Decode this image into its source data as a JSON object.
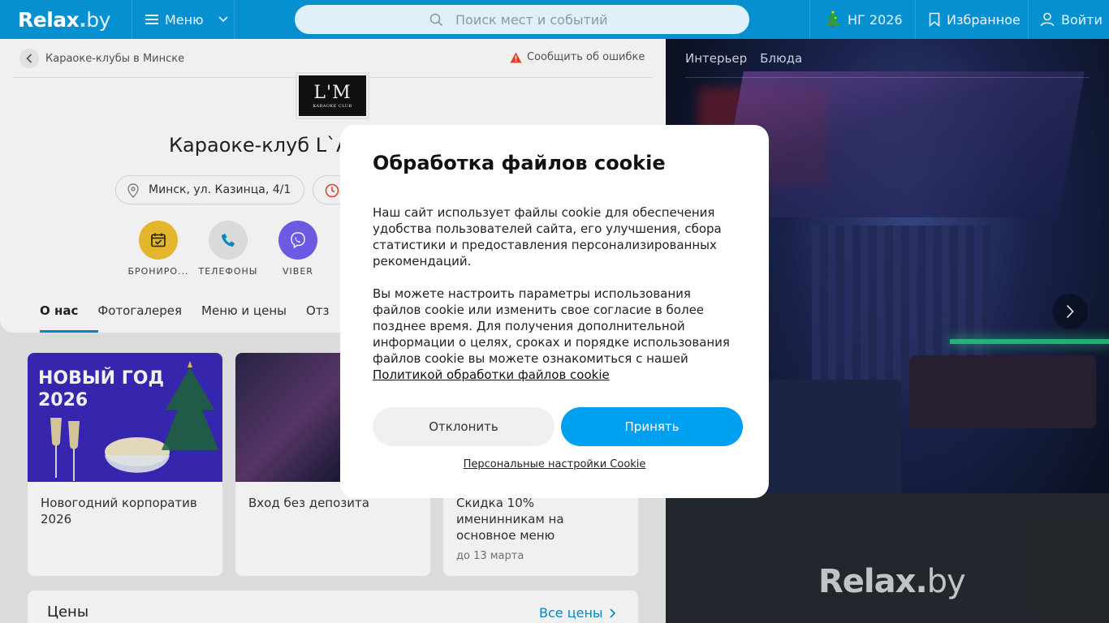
{
  "header": {
    "logo_main": "Relax",
    "logo_dot": ".",
    "logo_by": "by",
    "menu_label": "Меню",
    "search_placeholder": "Поиск мест и событий",
    "ng_label": "НГ 2026",
    "favorites_label": "Избранное",
    "login_label": "Войти",
    "colors": {
      "header_bg": "#0690d0",
      "accent": "#00a0f0"
    }
  },
  "venue": {
    "breadcrumb": "Караоке-клубы в Минске",
    "report_error": "Сообщить об ошибке",
    "logo_text": "L'M",
    "logo_sub": "KARAOKE CLUB",
    "title": "Караоке-клуб L`A",
    "address": "Минск, ул. Казинца, 4/1",
    "actions": [
      {
        "label": "БРОНИРО...",
        "icon": "calendar-check-icon",
        "color": "#f2c230"
      },
      {
        "label": "ТЕЛЕФОНЫ",
        "icon": "phone-icon",
        "color": "#e8e8e8"
      },
      {
        "label": "VIBER",
        "icon": "viber-icon",
        "color": "#7360f2"
      }
    ],
    "tabs": [
      "О нас",
      "Фотогалерея",
      "Меню и цены",
      "Отз"
    ]
  },
  "promos": [
    {
      "image_title": "НОВЫЙ ГОД\n2026",
      "text": "Новогодний корпоратив 2026",
      "date": ""
    },
    {
      "image_title": "",
      "text": "Вход без депозита",
      "date": ""
    },
    {
      "image_title": "",
      "text": "Скидка 10% именинникам на основное меню",
      "date": "до 13 марта"
    }
  ],
  "prices": {
    "heading": "Цены",
    "all_link": "Все цены"
  },
  "gallery": {
    "tabs": [
      "Интерьер",
      "Блюда"
    ],
    "watermark_main": "Relax",
    "watermark_dot": ".",
    "watermark_by": "by"
  },
  "cookie_modal": {
    "title": "Обработка файлов cookie",
    "paragraph1": "Наш сайт использует файлы cookie для обеспечения удобства пользователей сайта, его улучшения, сбора статистики и предоставления персонализированных рекомендаций.",
    "paragraph2": "Вы можете настроить параметры использования файлов cookie или изменить свое согласие в более позднее время. Для получения дополнительной информации о целях, сроках и порядке использования файлов cookie вы можете ознакомиться с нашей",
    "policy_link": "Политикой обработки файлов cookie",
    "decline_label": "Отклонить",
    "accept_label": "Принять",
    "personal_settings": "Персональные настройки Cookie"
  }
}
